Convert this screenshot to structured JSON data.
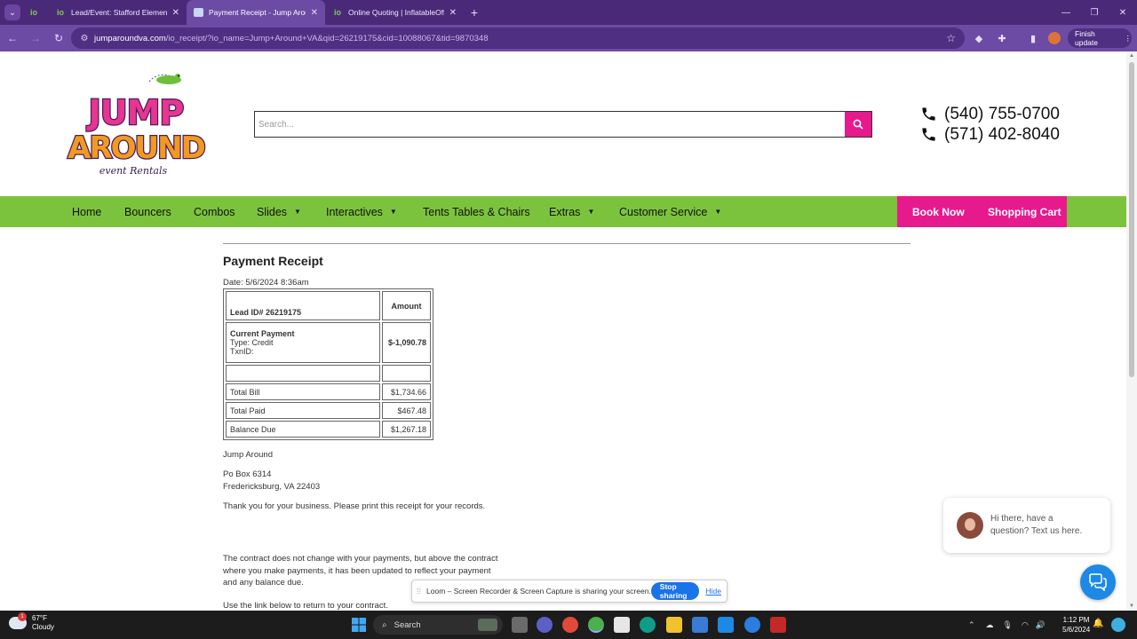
{
  "browser": {
    "tabs": [
      {
        "label": "Lead/Event: Stafford Elementary"
      },
      {
        "label": "Payment Receipt - Jump Around"
      },
      {
        "label": "Online Quoting | InflatableOffice"
      }
    ],
    "pinned_tab_label": "io",
    "tab_favicon_label": "io",
    "url_host": "jumparoundva.com",
    "url_path": "/io_receipt/?io_name=Jump+Around+VA&qid=26219175&cid=10088067&tid=9870348",
    "finish_update_label": "Finish update"
  },
  "site": {
    "logo": {
      "line1": "JUMP",
      "line2": "AROUND",
      "tagline": "event Rentals"
    },
    "search_placeholder": "Search...",
    "phones": [
      "(540) 755-0700",
      "(571) 402-8040"
    ],
    "nav": {
      "home": "Home",
      "bouncers": "Bouncers",
      "combos": "Combos",
      "slides": "Slides",
      "interactives": "Interactives",
      "tents": "Tents Tables & Chairs",
      "extras": "Extras",
      "customer_service": "Customer Service",
      "book_now": "Book Now",
      "shopping_cart": "Shopping Cart"
    }
  },
  "receipt": {
    "title": "Payment Receipt",
    "date": "Date: 5/6/2024 8:36am",
    "lead_id": "Lead ID# 26219175",
    "amount_header": "Amount",
    "current_payment_label": "Current Payment",
    "type": "Type: Credit",
    "txn": "TxnID:",
    "current_payment_amount": "$-1,090.78",
    "total_bill_label": "Total Bill",
    "total_bill": "$1,734.66",
    "total_paid_label": "Total Paid",
    "total_paid": "$467.48",
    "balance_due_label": "Balance Due",
    "balance_due": "$1,267.18",
    "company": "Jump Around",
    "address1": "Po Box 6314",
    "address2": "Fredericksburg, VA 22403",
    "thanks": "Thank you for your business. Please print this receipt for your records.",
    "contract1": "The contract does not change with your payments, but above the contract",
    "contract2": "where you make payments, it has been updated to reflect your payment",
    "contract3": "and any balance due.",
    "link_line": "Use the link below to return to your contract."
  },
  "chat": {
    "line1": "Hi there, have a",
    "line2": "question? Text us here."
  },
  "loom": {
    "message": "Loom – Screen Recorder & Screen Capture is sharing your screen.",
    "stop": "Stop sharing",
    "hide": "Hide"
  },
  "taskbar": {
    "weather_temp": "67°F",
    "weather_cond": "Cloudy",
    "weather_badge": "1",
    "search": "Search",
    "time": "1:12 PM",
    "date": "5/6/2024"
  },
  "colors": {
    "nav_green": "#7cc33d",
    "brand_pink": "#e61a8d",
    "chrome_purple": "#6b4ba3"
  }
}
